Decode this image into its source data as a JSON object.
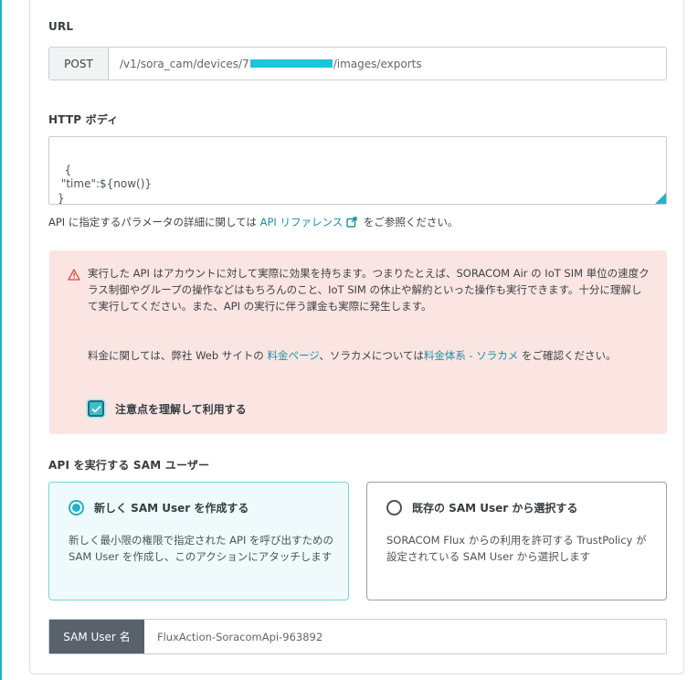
{
  "url_section": {
    "label": "URL",
    "method": "POST",
    "path_prefix": "/v1/sora_cam/devices/7",
    "path_suffix": "/images/exports"
  },
  "http_body": {
    "label": "HTTP ボディ",
    "value": "{\n \"time\":${now()}\n}"
  },
  "help": {
    "before": "API に指定するパラメータの詳細に関しては ",
    "link": "API リファレンス",
    "after": " をご参照ください。"
  },
  "warning": {
    "icon": "warning-triangle-icon",
    "paragraph1": "実行した API はアカウントに対して実際に効果を持ちます。つまりたとえば、SORACOM Air の IoT SIM 単位の速度クラス制御やグループの操作などはもちろんのこと、IoT SIM の休止や解約といった操作も実行できます。十分に理解して実行してください。また、API の実行に伴う課金も実際に発生します。",
    "p2_before": "料金に関しては、弊社 Web サイトの ",
    "p2_link1": "料金ページ",
    "p2_middle": "、ソラカメについては",
    "p2_link2": "料金体系 - ソラカメ",
    "p2_after": " をご確認ください。",
    "checkbox_label": "注意点を理解して利用する",
    "checkbox_checked": true
  },
  "sam_section": {
    "label": "API を実行する SAM ユーザー",
    "option_new": {
      "title": "新しく SAM User を作成する",
      "description": "新しく最小限の権限で指定された API を呼び出すための SAM User を作成し、このアクションにアタッチします",
      "selected": true
    },
    "option_existing": {
      "title": "既存の SAM User から選択する",
      "description": "SORACOM Flux からの利用を許可する TrustPolicy が設定されている SAM User から選択します",
      "selected": false
    },
    "name_label": "SAM User 名",
    "name_value": "FluxAction-SoracomApi-963892"
  },
  "colors": {
    "accent": "#1fb3c5",
    "link": "#1b8fa8",
    "warning_bg": "#fbe5e2",
    "warning_icon": "#d9473b"
  }
}
